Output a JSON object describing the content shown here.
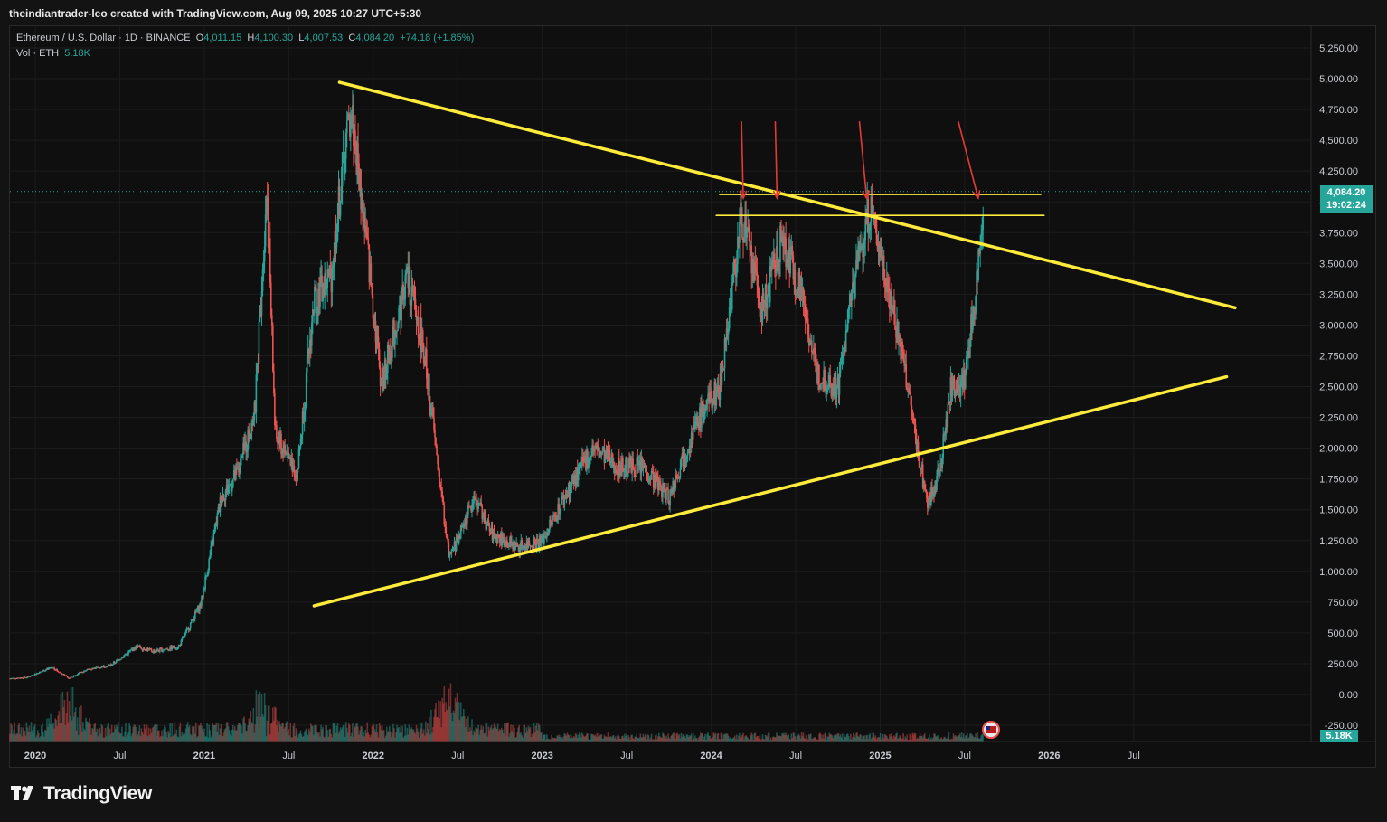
{
  "header": {
    "attribution": "theindiantrader-leo created with TradingView.com, Aug 09, 2025 10:27 UTC+5:30"
  },
  "legend": {
    "symbol": "Ethereum / U.S. Dollar · 1D · BINANCE",
    "o_label": "O",
    "o_value": "4,011.15",
    "h_label": "H",
    "h_value": "4,100.30",
    "l_label": "L",
    "l_value": "4,007.53",
    "c_label": "C",
    "c_value": "4,084.20",
    "change": "+74.18 (+1.85%)",
    "vol_label": "Vol · ETH",
    "vol_value": "5.18K"
  },
  "price_tag": {
    "price": "4,084.20",
    "countdown": "19:02:24"
  },
  "volume_tag": "5.18K",
  "brand": {
    "name": "TradingView"
  },
  "colors": {
    "up": "#26a69a",
    "down": "#ef5350",
    "trendline": "#ffeb3b",
    "arrow": "#e53935",
    "background": "#0f0f0f"
  },
  "chart_data": {
    "type": "candlestick",
    "symbol": "ETHUSD",
    "interval": "1D",
    "exchange": "BINANCE",
    "y_axis": {
      "ticks": [
        -250,
        0,
        250,
        500,
        750,
        1000,
        1250,
        1500,
        1750,
        2000,
        2250,
        2500,
        2750,
        3000,
        3250,
        3500,
        3750,
        4000,
        4250,
        4500,
        4750,
        5000,
        5250
      ],
      "tick_labels": [
        "-250.00",
        "0.00",
        "250.00",
        "500.00",
        "750.00",
        "1,000.00",
        "1,250.00",
        "1,500.00",
        "1,750.00",
        "2,000.00",
        "2,250.00",
        "2,500.00",
        "2,750.00",
        "3,000.00",
        "3,250.00",
        "3,500.00",
        "3,750.00",
        "4,000.00",
        "4,250.00",
        "4,500.00",
        "4,750.00",
        "5,000.00",
        "5,250.00"
      ],
      "range": [
        -330,
        5400
      ]
    },
    "x_axis": {
      "ticks": [
        {
          "t": 2020.0,
          "label": "2020"
        },
        {
          "t": 2020.5,
          "label": "Jul"
        },
        {
          "t": 2021.0,
          "label": "2021"
        },
        {
          "t": 2021.5,
          "label": "Jul"
        },
        {
          "t": 2022.0,
          "label": "2022"
        },
        {
          "t": 2022.5,
          "label": "Jul"
        },
        {
          "t": 2023.0,
          "label": "2023"
        },
        {
          "t": 2023.5,
          "label": "Jul"
        },
        {
          "t": 2024.0,
          "label": "2024"
        },
        {
          "t": 2024.5,
          "label": "Jul"
        },
        {
          "t": 2025.0,
          "label": "2025"
        },
        {
          "t": 2025.5,
          "label": "Jul"
        },
        {
          "t": 2026.0,
          "label": "2026"
        },
        {
          "t": 2026.5,
          "label": "Jul"
        }
      ],
      "range": [
        2019.85,
        2027.55
      ]
    },
    "price_path": [
      [
        2019.85,
        130
      ],
      [
        2019.95,
        140
      ],
      [
        2020.1,
        220
      ],
      [
        2020.2,
        130
      ],
      [
        2020.3,
        200
      ],
      [
        2020.45,
        240
      ],
      [
        2020.6,
        390
      ],
      [
        2020.7,
        350
      ],
      [
        2020.85,
        390
      ],
      [
        2020.98,
        740
      ],
      [
        2021.1,
        1600
      ],
      [
        2021.2,
        1800
      ],
      [
        2021.3,
        2300
      ],
      [
        2021.37,
        4150
      ],
      [
        2021.42,
        2100
      ],
      [
        2021.55,
        1800
      ],
      [
        2021.65,
        3200
      ],
      [
        2021.75,
        3400
      ],
      [
        2021.83,
        4400
      ],
      [
        2021.87,
        4750
      ],
      [
        2021.95,
        3800
      ],
      [
        2022.05,
        2500
      ],
      [
        2022.2,
        3400
      ],
      [
        2022.3,
        2800
      ],
      [
        2022.45,
        1100
      ],
      [
        2022.6,
        1600
      ],
      [
        2022.7,
        1300
      ],
      [
        2022.85,
        1200
      ],
      [
        2023.0,
        1250
      ],
      [
        2023.15,
        1650
      ],
      [
        2023.3,
        2000
      ],
      [
        2023.45,
        1850
      ],
      [
        2023.6,
        1850
      ],
      [
        2023.75,
        1600
      ],
      [
        2023.85,
        2000
      ],
      [
        2023.95,
        2300
      ],
      [
        2024.05,
        2500
      ],
      [
        2024.18,
        3900
      ],
      [
        2024.3,
        3100
      ],
      [
        2024.42,
        3700
      ],
      [
        2024.55,
        3200
      ],
      [
        2024.62,
        2600
      ],
      [
        2024.75,
        2500
      ],
      [
        2024.85,
        3400
      ],
      [
        2024.94,
        3950
      ],
      [
        2025.05,
        3300
      ],
      [
        2025.15,
        2600
      ],
      [
        2025.22,
        2000
      ],
      [
        2025.28,
        1550
      ],
      [
        2025.35,
        1800
      ],
      [
        2025.42,
        2500
      ],
      [
        2025.5,
        2550
      ],
      [
        2025.56,
        3200
      ],
      [
        2025.6,
        3800
      ],
      [
        2025.61,
        4084
      ]
    ],
    "volume": {
      "last": "5.18K",
      "peak_dates": [
        2020.2,
        2021.35,
        2022.45
      ]
    },
    "last_price": 4084.2,
    "trendlines": [
      {
        "name": "descending resistance",
        "from": [
          2021.8,
          4970
        ],
        "to": [
          2027.1,
          3140
        ]
      },
      {
        "name": "ascending support",
        "from": [
          2021.65,
          720
        ],
        "to": [
          2027.05,
          2580
        ]
      },
      {
        "name": "horizontal resistance upper",
        "from": [
          2024.05,
          4060
        ],
        "to": [
          2025.95,
          4060
        ]
      },
      {
        "name": "horizontal resistance lower",
        "from": [
          2024.03,
          3890
        ],
        "to": [
          2025.97,
          3890
        ]
      }
    ],
    "arrows": [
      {
        "tip": [
          2024.19,
          4030
        ]
      },
      {
        "tip": [
          2024.39,
          4030
        ]
      },
      {
        "tip": [
          2024.92,
          4030
        ]
      },
      {
        "tip": [
          2025.58,
          4030
        ]
      }
    ]
  }
}
